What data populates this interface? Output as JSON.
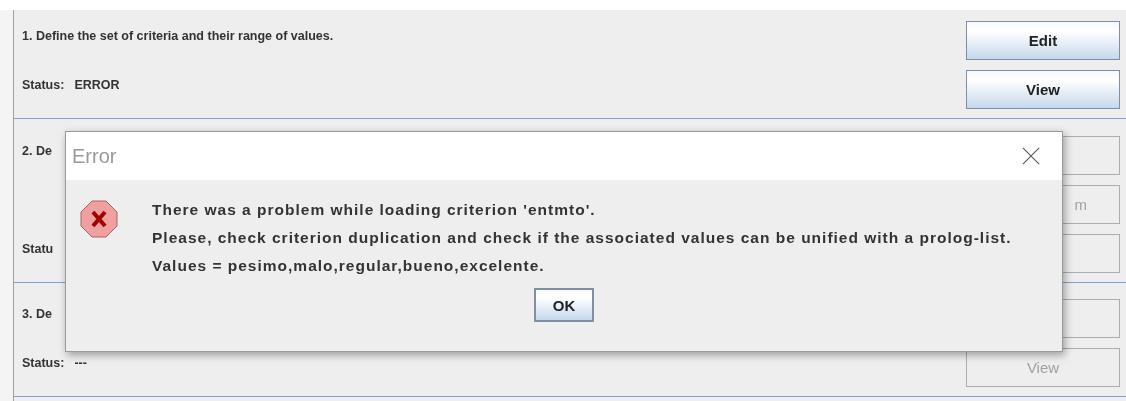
{
  "sections": [
    {
      "title": "1. Define the set of criteria and their range of values.",
      "status_label": "Status:",
      "status": "ERROR",
      "buttons": [
        {
          "label": "Edit",
          "disabled": false
        },
        {
          "label": "View",
          "disabled": false
        }
      ]
    },
    {
      "title": "2. De",
      "status_label": "Statu",
      "buttons": [
        {
          "disabled": true
        },
        {
          "label": "m",
          "disabled": true,
          "kind": "clipped"
        },
        {
          "disabled": true
        }
      ]
    },
    {
      "title": "3. De",
      "status_label": "Status:",
      "status": "---",
      "buttons": [
        {
          "disabled": true
        },
        {
          "label": "View",
          "disabled": true
        }
      ]
    }
  ],
  "dialog": {
    "title": "Error",
    "message": [
      "There was a problem while loading criterion 'entmto'.",
      "Please, check criterion duplication and check if the associated values can be unified with a prolog-list.",
      "Values = pesimo,malo,regular,bueno,excelente."
    ],
    "button": "OK"
  }
}
